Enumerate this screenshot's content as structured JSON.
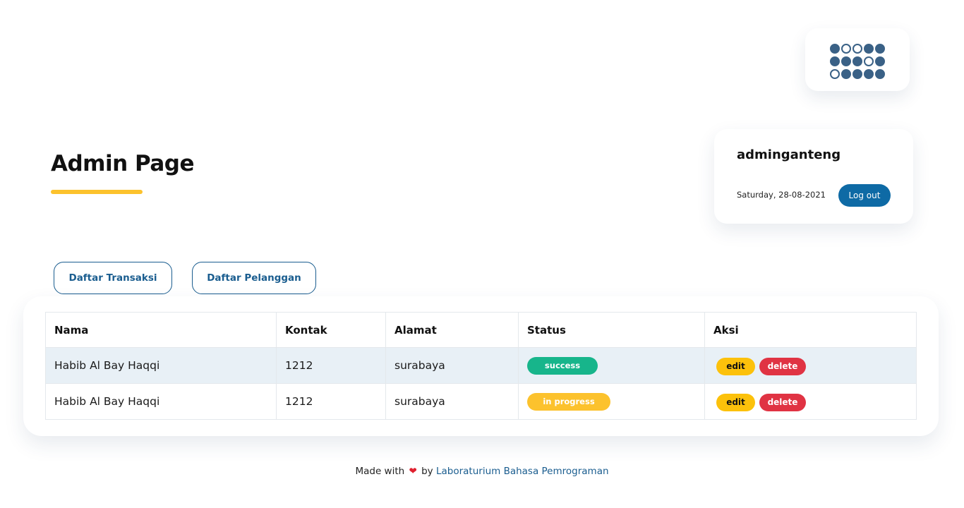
{
  "logo": {
    "icon": "dot-grid-logo",
    "pattern": [
      [
        1,
        0,
        0,
        1,
        1
      ],
      [
        1,
        1,
        1,
        0,
        1
      ],
      [
        0,
        1,
        1,
        1,
        1
      ]
    ],
    "color": "#3a6186"
  },
  "header": {
    "title": "Admin Page",
    "underline_color": "#fcc22d"
  },
  "user": {
    "username": "adminganteng",
    "date": "Saturday, 28-08-2021",
    "logout_label": "Log out"
  },
  "nav": {
    "transaksi_label": "Daftar Transaksi",
    "pelanggan_label": "Daftar Pelanggan"
  },
  "table": {
    "headers": [
      "Nama",
      "Kontak",
      "Alamat",
      "Status",
      "Aksi"
    ],
    "rows": [
      {
        "nama": "Habib Al Bay Haqqi",
        "kontak": "1212",
        "alamat": "surabaya",
        "status": "success",
        "edit": "edit",
        "delete": "delete"
      },
      {
        "nama": "Habib Al Bay Haqqi",
        "kontak": "1212",
        "alamat": "surabaya",
        "status": "in progress",
        "edit": "edit",
        "delete": "delete"
      }
    ]
  },
  "status_colors": {
    "success": "#17b58b",
    "in_progress": "#fcc22d"
  },
  "footer": {
    "prefix": "Made with",
    "heart_icon": "heart-icon",
    "by": "by",
    "link_text": "Laboraturium Bahasa Pemrograman"
  }
}
